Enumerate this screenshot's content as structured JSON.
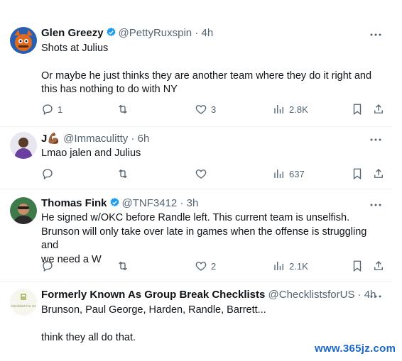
{
  "tweets": [
    {
      "name": "Glen Greezy",
      "handle": "@PettyRuxspin",
      "dot": "·",
      "time": "4h",
      "lines": [
        "Shots at Julius",
        "",
        "Or maybe he just thinks they are another team where they do it right and",
        "this has nothing to do with NY"
      ],
      "replies": "1",
      "retweets": "",
      "likes": "3",
      "views": "2.8K"
    },
    {
      "name": "J💪🏾",
      "handle": "@Immaculitty",
      "dot": "·",
      "time": "6h",
      "lines": [
        "Lmao jalen and Julius"
      ],
      "replies": "",
      "retweets": "",
      "likes": "",
      "views": "637"
    },
    {
      "name": "Thomas Fink",
      "handle": "@TNF3412",
      "dot": "·",
      "time": "3h",
      "lines": [
        "He signed w/OKC before Randle left. This current team is unselfish.",
        "Brunson will only take over late in games when the offense is struggling and",
        "we need a W"
      ],
      "replies": "",
      "retweets": "",
      "likes": "2",
      "views": "2.1K"
    },
    {
      "name": "Formerly Known As Group Break Checklists",
      "handle": "@ChecklistsforUS",
      "dot": "·",
      "time": "4h",
      "avatar_text": "Checklists For Us",
      "lines": [
        "Brunson, Paul George, Harden, Randle, Barrett...",
        "",
        "think they all do that."
      ]
    }
  ],
  "watermark": "www.365jz.com",
  "colors": {
    "text": "#0f1419",
    "muted": "#536471",
    "verified": "#1d9bf0",
    "watermark": "#1a66c9"
  }
}
